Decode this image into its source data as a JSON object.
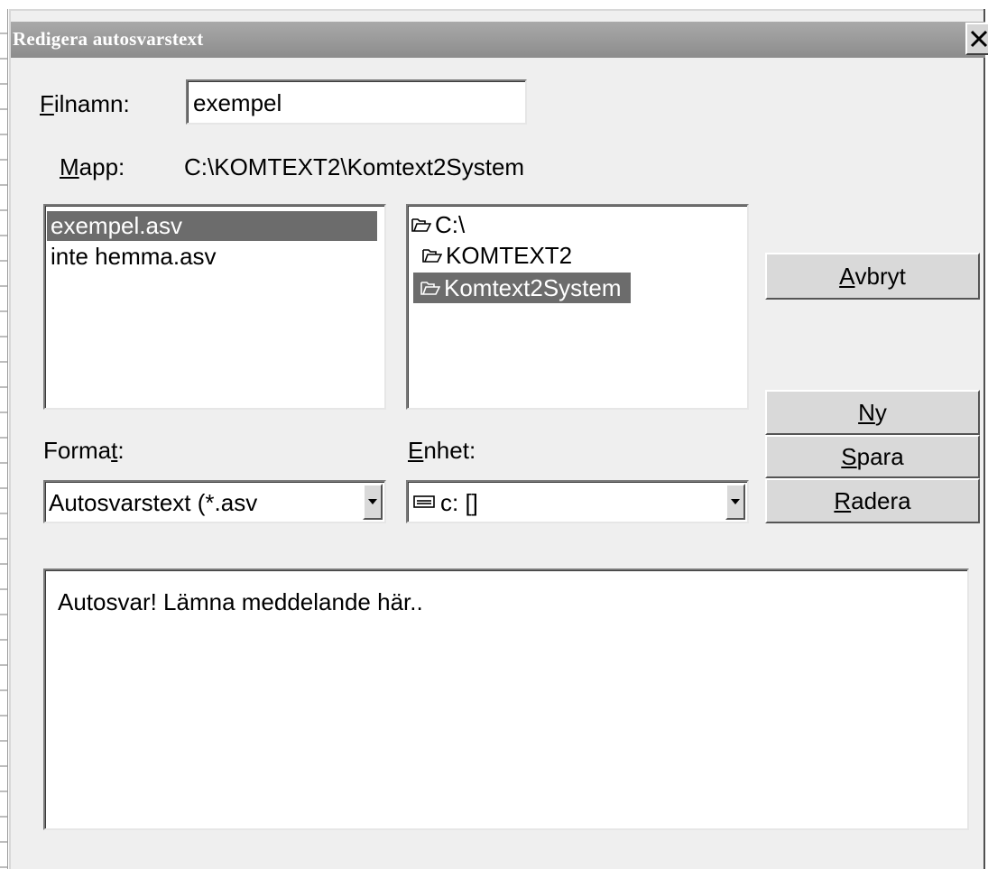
{
  "window": {
    "title": "Redigera autosvarstext"
  },
  "filename": {
    "label_accel": "F",
    "label_rest": "ilnamn:",
    "value": "exempel"
  },
  "folder": {
    "label_accel": "M",
    "label_rest": "app:",
    "path": "C:\\KOMTEXT2\\Komtext2System"
  },
  "file_list": {
    "items": [
      {
        "label": "exempel.asv",
        "selected": true
      },
      {
        "label": "inte hemma.asv",
        "selected": false
      }
    ]
  },
  "dir_tree": {
    "items": [
      {
        "label": "C:\\",
        "selected": false
      },
      {
        "label": "KOMTEXT2",
        "selected": false
      },
      {
        "label": "Komtext2System",
        "selected": true
      }
    ]
  },
  "format": {
    "label_pre": "Forma",
    "label_accel": "t",
    "label_post": ":",
    "selected": "Autosvarstext (*.asv"
  },
  "drive": {
    "label_accel": "E",
    "label_rest": "nhet:",
    "selected": "c: []"
  },
  "buttons": {
    "cancel": {
      "accel": "A",
      "rest": "vbryt"
    },
    "new": {
      "accel": "N",
      "rest": "y"
    },
    "save": {
      "accel": "S",
      "rest": "para"
    },
    "delete": {
      "accel": "R",
      "rest": "adera"
    }
  },
  "message": {
    "text": "Autosvar! Lämna meddelande här.."
  },
  "icons": {
    "close": "close-icon",
    "folder_closed": "folder-icon",
    "folder_open": "folder-open-icon",
    "drive": "drive-icon",
    "dropdown": "chevron-down-icon"
  },
  "colors": {
    "titlebar": "#8c8c8c",
    "selection": "#6c6c6c",
    "dialog_bg": "#efefef"
  }
}
